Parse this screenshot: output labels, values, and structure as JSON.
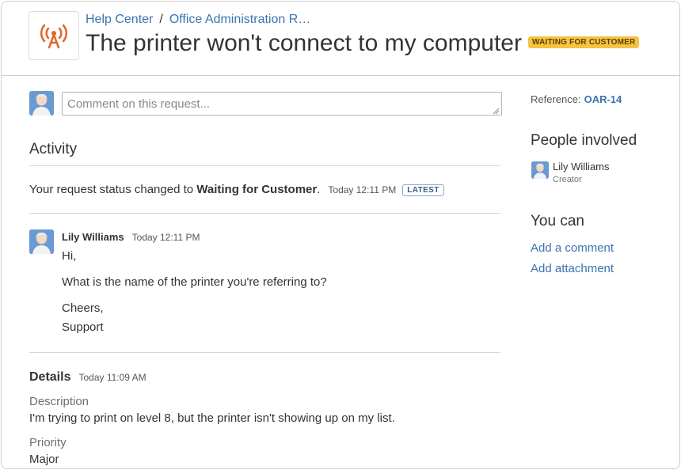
{
  "header": {
    "breadcrumb": [
      {
        "label": "Help Center"
      },
      {
        "label": "Office Administration R…"
      }
    ],
    "breadcrumb_separator": "/",
    "title": "The printer won't connect to my computer",
    "status_badge": "WAITING FOR CUSTOMER",
    "project_icon": "broadcast-tower-icon",
    "colors": {
      "accent": "#d04437",
      "link": "#3b73af",
      "status_badge_bg": "#f6c342"
    }
  },
  "comment": {
    "placeholder": "Comment on this request..."
  },
  "activity": {
    "heading": "Activity",
    "status_change": {
      "prefix": "Your request status changed to ",
      "status": "Waiting for Customer",
      "suffix": ".",
      "time": "Today 12:11 PM",
      "badge": "LATEST"
    },
    "message": {
      "author": "Lily Williams",
      "time": "Today 12:11 PM",
      "lines": [
        "Hi,",
        "What is the name of the printer you're referring to?",
        "Cheers,",
        "Support"
      ]
    }
  },
  "details": {
    "heading": "Details",
    "time": "Today 11:09 AM",
    "fields": [
      {
        "label": "Description",
        "value": "I'm trying to print on level 8, but the printer isn't showing up on my list."
      },
      {
        "label": "Priority",
        "value": "Major"
      }
    ]
  },
  "sidebar": {
    "reference_label": "Reference:",
    "reference_value": "OAR-14",
    "people_heading": "People involved",
    "people": [
      {
        "name": "Lily Williams",
        "role": "Creator"
      }
    ],
    "you_can_heading": "You can",
    "actions": [
      {
        "label": "Add a comment"
      },
      {
        "label": "Add attachment"
      }
    ]
  }
}
